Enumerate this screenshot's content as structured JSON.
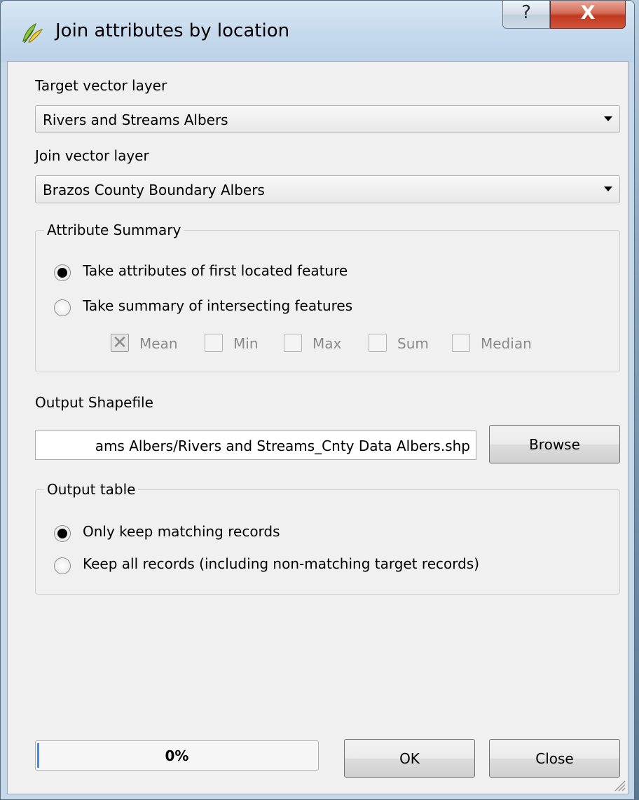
{
  "window": {
    "title": "Join attributes by location",
    "help_label": "?",
    "close_label": "X"
  },
  "target_layer": {
    "label": "Target vector layer",
    "value": "Rivers and Streams Albers"
  },
  "join_layer": {
    "label": "Join vector layer",
    "value": "Brazos County Boundary Albers"
  },
  "attribute_summary": {
    "title": "Attribute Summary",
    "options": [
      {
        "label": "Take attributes of first located feature",
        "selected": true
      },
      {
        "label": "Take summary of intersecting features",
        "selected": false
      }
    ],
    "stats": [
      {
        "label": "Mean",
        "checked": true
      },
      {
        "label": "Min",
        "checked": false
      },
      {
        "label": "Max",
        "checked": false
      },
      {
        "label": "Sum",
        "checked": false
      },
      {
        "label": "Median",
        "checked": false
      }
    ]
  },
  "output": {
    "label": "Output Shapefile",
    "value": "ams Albers/Rivers and Streams_Cnty Data Albers.shp",
    "browse_label": "Browse"
  },
  "output_table": {
    "title": "Output table",
    "options": [
      {
        "label": "Only keep matching records",
        "selected": true
      },
      {
        "label": "Keep all records (including non-matching target records)",
        "selected": false
      }
    ]
  },
  "footer": {
    "progress_text": "0%",
    "progress_value": 0,
    "ok_label": "OK",
    "close_label": "Close"
  },
  "colors": {
    "accent": "#3a8ee6",
    "title_close": "#c0391f"
  }
}
